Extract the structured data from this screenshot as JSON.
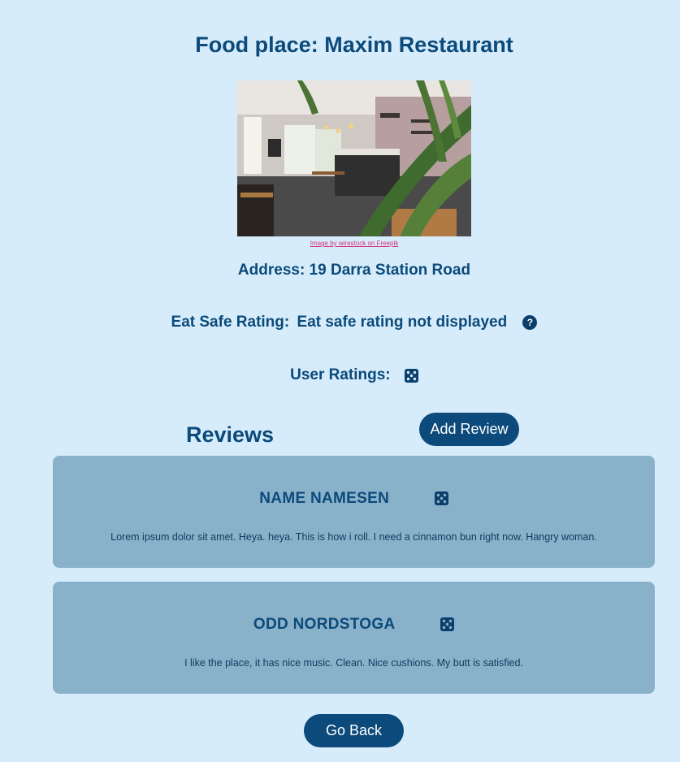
{
  "page": {
    "title": "Food place: Maxim Restaurant"
  },
  "image": {
    "credit": "Image by wirestock on Freepik"
  },
  "address": {
    "label": "Address: 19 Darra Station Road"
  },
  "eat_safe": {
    "label": "Eat Safe Rating:",
    "value": "Eat safe rating not displayed",
    "help_icon": "?"
  },
  "user_ratings": {
    "label": "User Ratings:",
    "dice_icon": "dice-five-icon"
  },
  "reviews": {
    "heading": "Reviews",
    "add_label": "Add Review",
    "items": [
      {
        "name": "NAME NAMESEN",
        "text": "Lorem ipsum dolor sit amet. Heya. heya. This is how i roll. I need a cinnamon bun right now. Hangry woman."
      },
      {
        "name": "ODD NORDSTOGA",
        "text": "I like the place, it has nice music. Clean. Nice cushions. My butt is satisfied."
      }
    ]
  },
  "footer": {
    "back_label": "Go Back"
  },
  "colors": {
    "background": "#d6ecfb",
    "primary": "#0b4a7a",
    "card": "#8ab1ca",
    "credit_link": "#d3337a"
  }
}
